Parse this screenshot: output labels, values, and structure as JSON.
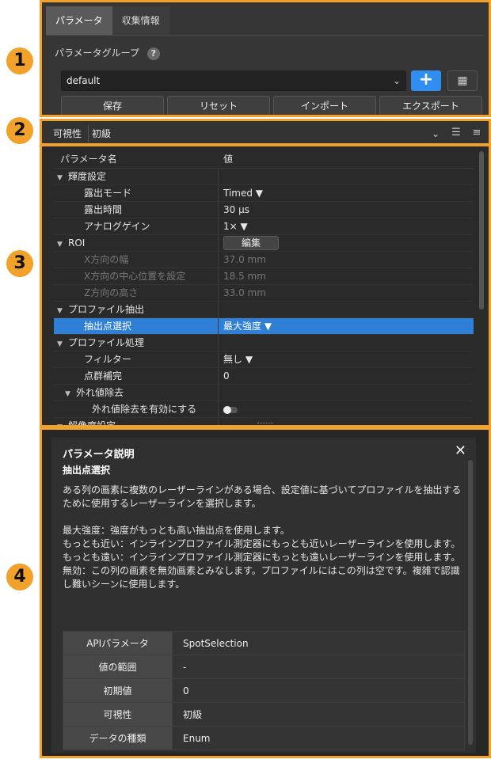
{
  "badges": [
    "1",
    "2",
    "3",
    "4"
  ],
  "tabs": [
    {
      "label": "パラメータ",
      "active": true
    },
    {
      "label": "収集情報",
      "active": false
    }
  ],
  "param_group": {
    "label": "パラメータグループ",
    "help": "?",
    "value": "default",
    "buttons": [
      "保存",
      "リセット",
      "インポート",
      "エクスポート"
    ]
  },
  "visibility": {
    "label": "可視性",
    "value": "初級"
  },
  "tree": {
    "headers": [
      "パラメータ名",
      "値"
    ],
    "rows": [
      {
        "indent": 0,
        "arrow": "▼",
        "name": "輝度設定",
        "value": ""
      },
      {
        "indent": 2,
        "arrow": "",
        "name": "露出モード",
        "value": "Timed ▼"
      },
      {
        "indent": 2,
        "arrow": "",
        "name": "露出時間",
        "value": "30 μs"
      },
      {
        "indent": 2,
        "arrow": "",
        "name": "アナログゲイン",
        "value": "1× ▼"
      },
      {
        "indent": 0,
        "arrow": "▼",
        "name": "ROI",
        "value": "",
        "button": "編集"
      },
      {
        "indent": 2,
        "arrow": "",
        "name": "X方向の幅",
        "value": "37.0 mm",
        "dim": true
      },
      {
        "indent": 2,
        "arrow": "",
        "name": "X方向の中心位置を設定",
        "value": "18.5 mm",
        "dim": true
      },
      {
        "indent": 2,
        "arrow": "",
        "name": "Z方向の高さ",
        "value": "33.0 mm",
        "dim": true
      },
      {
        "indent": 0,
        "arrow": "▼",
        "name": "プロファイル抽出",
        "value": ""
      },
      {
        "indent": 2,
        "arrow": "",
        "name": "抽出点選択",
        "value": "最大強度 ▼",
        "selected": true
      },
      {
        "indent": 0,
        "arrow": "▼",
        "name": "プロファイル処理",
        "value": ""
      },
      {
        "indent": 2,
        "arrow": "",
        "name": "フィルター",
        "value": "無し ▼"
      },
      {
        "indent": 2,
        "arrow": "",
        "name": "点群補完",
        "value": "0"
      },
      {
        "indent": 1,
        "arrow": "▼",
        "name": "外れ値除去",
        "value": ""
      },
      {
        "indent": 3,
        "arrow": "",
        "name": "外れ値除去を有効にする",
        "value": "",
        "toggle": true
      },
      {
        "indent": 0,
        "arrow": "▼",
        "name": "解像度設定",
        "value": ""
      }
    ]
  },
  "description": {
    "title": "パラメータ説明",
    "close": "✕",
    "subtitle": "抽出点選択",
    "paragraph1": "ある列の画素に複数のレーザーラインがある場合、設定値に基づいてプロファイルを抽出するために使用するレーザーラインを選択します。",
    "lines": [
      "最大強度：強度がもっとも高い抽出点を使用します。",
      "もっとも近い：インラインプロファイル測定器にもっとも近いレーザーラインを使用します。",
      "もっとも遠い：インラインプロファイル測定器にもっとも遠いレーザーラインを使用します。",
      "無効：この列の画素を無効画素とみなします。プロファイルにはこの列は空です。複雑で認識し難いシーンに使用します。"
    ],
    "table": [
      {
        "key": "APIパラメータ",
        "value": "SpotSelection"
      },
      {
        "key": "値の範囲",
        "value": "-"
      },
      {
        "key": "初期値",
        "value": "0"
      },
      {
        "key": "可視性",
        "value": "初級"
      },
      {
        "key": "データの種類",
        "value": "Enum"
      }
    ]
  },
  "colors": {
    "accent": "#f2a12a",
    "primary_button": "#2f8ef0",
    "selection": "#2f7fd6"
  }
}
